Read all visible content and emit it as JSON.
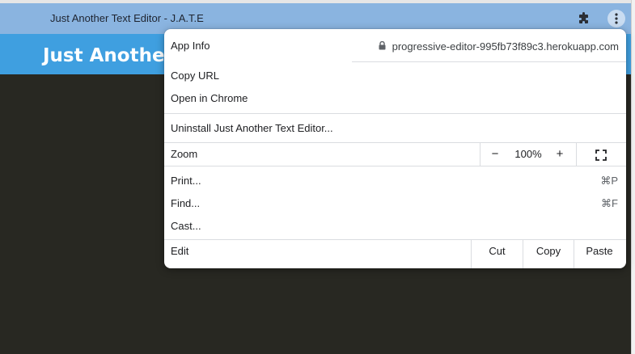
{
  "window": {
    "title": "Just Another Text Editor - J.A.T.E",
    "icons": {
      "extensions": "puzzle-icon",
      "menu": "kebab-menu-icon"
    }
  },
  "app": {
    "header_title": "Just Another Text Editor"
  },
  "menu": {
    "app_info": {
      "label": "App Info",
      "url": "progressive-editor-995fb73f89c3.herokuapp.com",
      "icon": "lock-icon"
    },
    "copy_url": "Copy URL",
    "open_in_chrome": "Open in Chrome",
    "uninstall": "Uninstall Just Another Text Editor...",
    "zoom": {
      "label": "Zoom",
      "minus": "−",
      "level": "100%",
      "plus": "+",
      "fullscreen_icon": "fullscreen-icon"
    },
    "print": {
      "label": "Print...",
      "shortcut": "⌘P"
    },
    "find": {
      "label": "Find...",
      "shortcut": "⌘F"
    },
    "cast": "Cast...",
    "edit": {
      "label": "Edit",
      "cut": "Cut",
      "copy": "Copy",
      "paste": "Paste"
    }
  },
  "colors": {
    "titlebar": "#8ab4e0",
    "app_header": "#3f9fe0",
    "editor_bg": "#282822",
    "menu_bg": "#ffffff"
  }
}
